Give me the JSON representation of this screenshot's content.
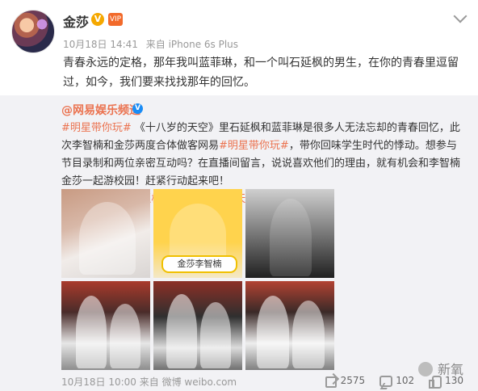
{
  "post": {
    "author": "金莎",
    "verified_label": "V",
    "vip_label": "VIP",
    "time": "10月18日 14:41",
    "source": "来自 iPhone 6s Plus",
    "text": "青春永远的定格，那年我叫蓝菲琳，和一个叫石延枫的男生，在你的青春里逗留过，如今，我们要来找找那年的回忆。"
  },
  "repost": {
    "author": "@网易娱乐频道",
    "author_verified_label": "V",
    "segments": [
      {
        "t": "#明星带你玩#",
        "hl": true
      },
      {
        "t": " 《十八岁的天空》里石延枫和蓝菲琳是很多人无法忘却的青春回忆，此次李智楠和金莎两度合体做客网易",
        "hl": false
      },
      {
        "t": "#明星带你玩#",
        "hl": true
      },
      {
        "t": "，带你回味学生时代的悸动。想参与节目录制和两位亲密互动吗？在直播间留言，说说喜欢他们的理由，就有机会和李智楠金莎一起游校园！赶紧行动起来吧！",
        "hl": false
      }
    ],
    "link": "🔗 金莎李智楠重返校园忆《十八岁的天空》",
    "time": "10月18日 10:00",
    "source": "来自 微博 weibo.com",
    "share_count": "2575",
    "comment_count": "102",
    "like_count": "130",
    "watermark": "新氧",
    "colors": {
      "link": "#eb7350",
      "verified": "#1a8cf5",
      "repost_bg": "#f2f2f5"
    },
    "images": [
      {
        "name": "photo-1",
        "caption": ""
      },
      {
        "name": "photo-2",
        "caption": "金莎李智楠"
      },
      {
        "name": "photo-3",
        "caption": ""
      },
      {
        "name": "photo-4",
        "caption": ""
      },
      {
        "name": "photo-5",
        "caption": ""
      },
      {
        "name": "photo-6",
        "caption": ""
      }
    ]
  }
}
